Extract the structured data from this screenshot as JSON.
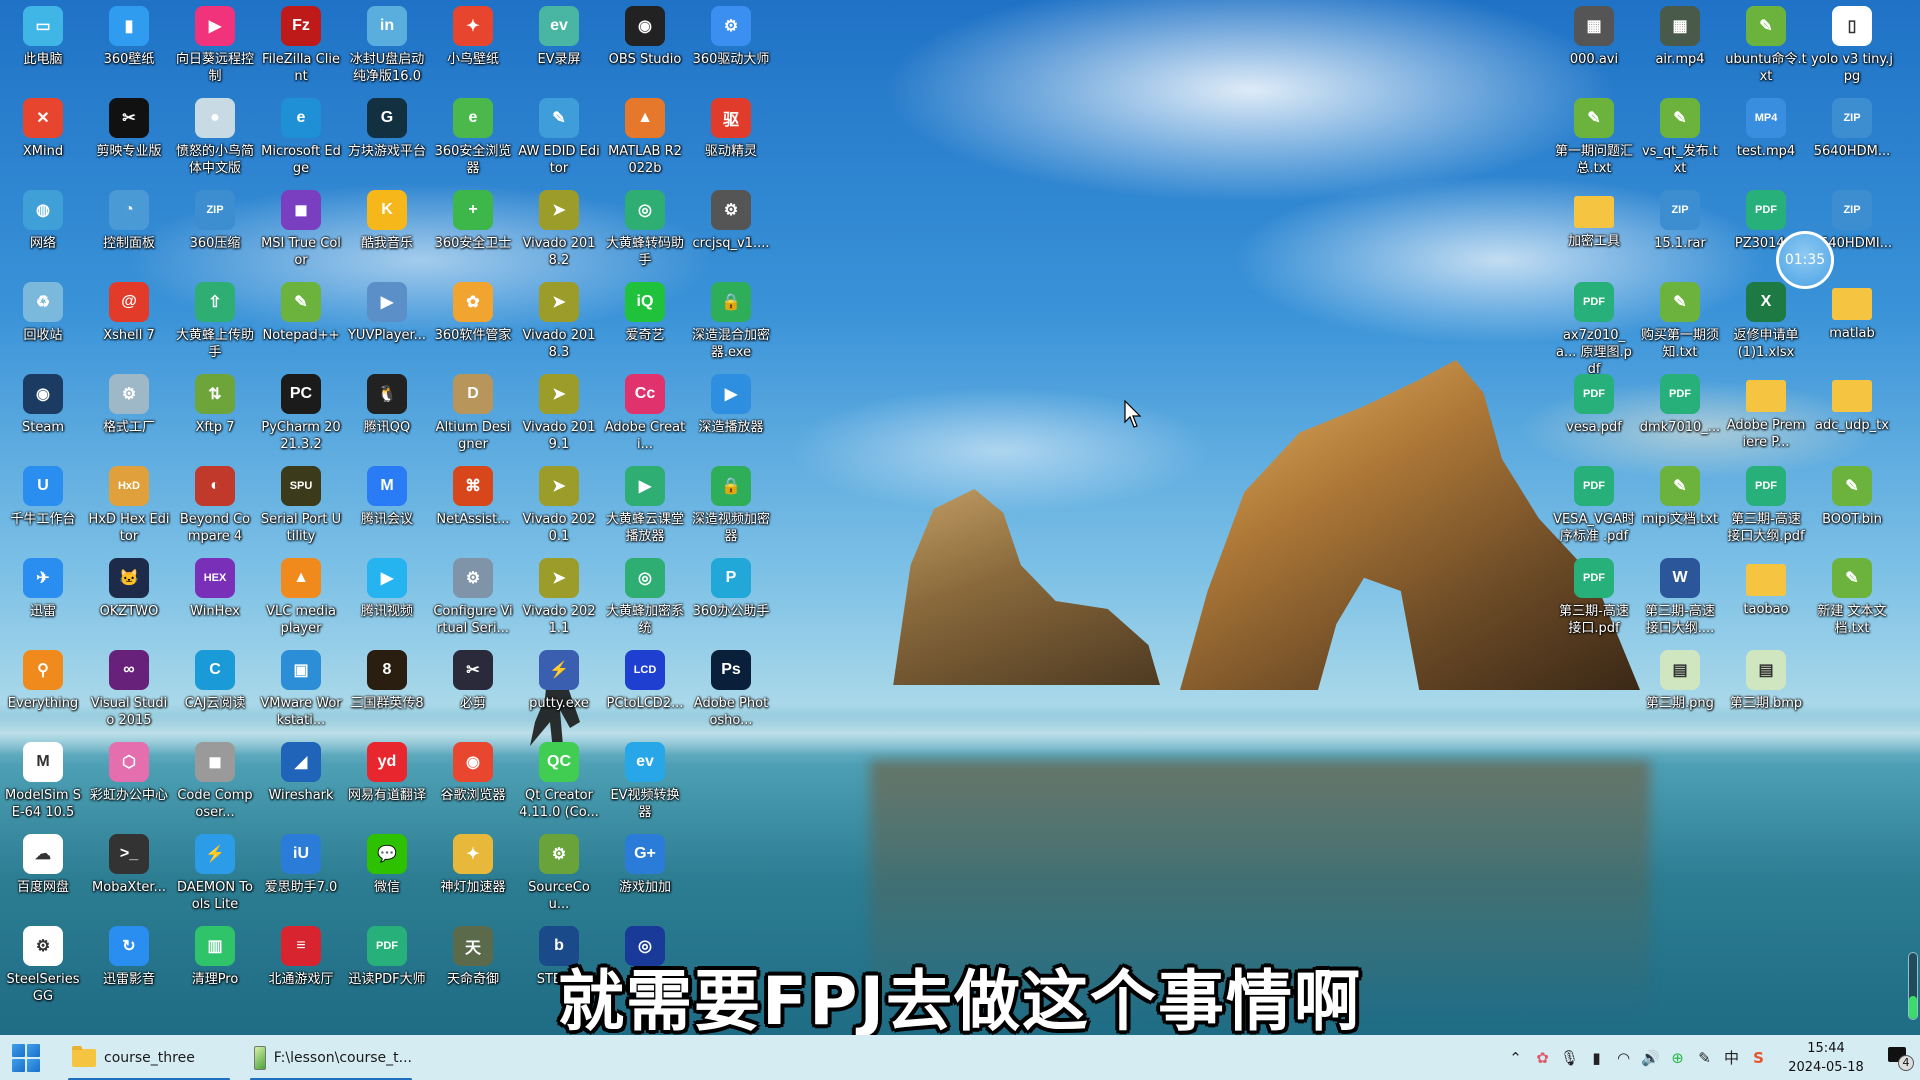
{
  "desktop": {
    "left_icons": [
      {
        "label": "此电脑",
        "icon": "this-pc-icon",
        "color": "#3fb6e6",
        "glyph": "▭"
      },
      {
        "label": "360壁纸",
        "icon": "360-wallpaper-icon",
        "color": "#2f9cf0",
        "glyph": "▮"
      },
      {
        "label": "向日葵远程控制",
        "icon": "sunlogin-icon",
        "color": "#f0337a",
        "glyph": "▶"
      },
      {
        "label": "FileZilla Client",
        "icon": "filezilla-icon",
        "color": "#bf1a1a",
        "glyph": "Fz"
      },
      {
        "label": "冰封U盘启动纯净版16.0",
        "icon": "usb-boot-icon",
        "color": "#5aaede",
        "glyph": "in"
      },
      {
        "label": "小鸟壁纸",
        "icon": "bird-wallpaper-icon",
        "color": "#e8452f",
        "glyph": "✦"
      },
      {
        "label": "EV录屏",
        "icon": "ev-recorder-icon",
        "color": "#49b6a4",
        "glyph": "ev"
      },
      {
        "label": "OBS Studio",
        "icon": "obs-icon",
        "color": "#222222",
        "glyph": "◉"
      },
      {
        "label": "360驱动大师",
        "icon": "360-driver-icon",
        "color": "#3a8ff0",
        "glyph": "⚙"
      },
      {
        "label": "XMind",
        "icon": "xmind-icon",
        "color": "#e8452f",
        "glyph": "✕"
      },
      {
        "label": "剪映专业版",
        "icon": "capcut-icon",
        "color": "#111111",
        "glyph": "✂"
      },
      {
        "label": "愤怒的小鸟简体中文版",
        "icon": "angry-birds-icon",
        "color": "#c8dbe4",
        "glyph": "●"
      },
      {
        "label": "Microsoft Edge",
        "icon": "edge-icon",
        "color": "#1f8fd6",
        "glyph": "e"
      },
      {
        "label": "方块游戏平台",
        "icon": "block-games-icon",
        "color": "#12303f",
        "glyph": "G"
      },
      {
        "label": "360安全浏览器",
        "icon": "360-browser-icon",
        "color": "#4cb84c",
        "glyph": "e"
      },
      {
        "label": "AW EDID Editor",
        "icon": "edid-editor-icon",
        "color": "#3f9ed9",
        "glyph": "✎"
      },
      {
        "label": "MATLAB R2022b",
        "icon": "matlab-icon",
        "color": "#e5782a",
        "glyph": "▲"
      },
      {
        "label": "驱动精灵",
        "icon": "driver-genius-icon",
        "color": "#e13b2c",
        "glyph": "驱"
      },
      {
        "label": "网络",
        "icon": "network-icon",
        "color": "#3fa0d8",
        "glyph": "◍"
      },
      {
        "label": "控制面板",
        "icon": "control-panel-icon",
        "color": "#4a9ad6",
        "glyph": "◔"
      },
      {
        "label": "360压缩",
        "icon": "360-zip-icon",
        "color": "#3c8ed0",
        "glyph": "ZIP"
      },
      {
        "label": "MSI True Color",
        "icon": "msi-truecolor-icon",
        "color": "#7a3fc0",
        "glyph": "◼"
      },
      {
        "label": "酷我音乐",
        "icon": "kuwo-music-icon",
        "color": "#f6b71a",
        "glyph": "K"
      },
      {
        "label": "360安全卫士",
        "icon": "360-security-icon",
        "color": "#3db74a",
        "glyph": "+"
      },
      {
        "label": "Vivado 2018.2",
        "icon": "vivado-icon",
        "color": "#9c9c2a",
        "glyph": "➤"
      },
      {
        "label": "大黄蜂转码助手",
        "icon": "transcode-helper-icon",
        "color": "#2fae74",
        "glyph": "◎"
      },
      {
        "label": "crcjsq_v1....",
        "icon": "crc-calc-icon",
        "color": "#555555",
        "glyph": "⚙"
      },
      {
        "label": "回收站",
        "icon": "recycle-bin-icon",
        "color": "#7ab8dc",
        "glyph": "♻"
      },
      {
        "label": "Xshell 7",
        "icon": "xshell-icon",
        "color": "#e23b2a",
        "glyph": "@"
      },
      {
        "label": "大黄蜂上传助手",
        "icon": "upload-helper-icon",
        "color": "#2fae74",
        "glyph": "⇧"
      },
      {
        "label": "Notepad++",
        "icon": "notepadpp-icon",
        "color": "#6cb33e",
        "glyph": "✎"
      },
      {
        "label": "YUVPlayer...",
        "icon": "yuvplayer-icon",
        "color": "#5b8fc7",
        "glyph": "▶"
      },
      {
        "label": "360软件管家",
        "icon": "360-software-icon",
        "color": "#f1a530",
        "glyph": "✿"
      },
      {
        "label": "Vivado 2018.3",
        "icon": "vivado-icon",
        "color": "#9c9c2a",
        "glyph": "➤"
      },
      {
        "label": "爱奇艺",
        "icon": "iqiyi-icon",
        "color": "#1fc23a",
        "glyph": "iQ"
      },
      {
        "label": "深造混合加密器.exe",
        "icon": "mixed-encryptor-icon",
        "color": "#2fae5a",
        "glyph": "🔒"
      },
      {
        "label": "Steam",
        "icon": "steam-icon",
        "color": "#1b3b63",
        "glyph": "◉"
      },
      {
        "label": "格式工厂",
        "icon": "format-factory-icon",
        "color": "#9fb8c8",
        "glyph": "⚙"
      },
      {
        "label": "Xftp 7",
        "icon": "xftp-icon",
        "color": "#6ea53a",
        "glyph": "⇅"
      },
      {
        "label": "PyCharm 2021.3.2",
        "icon": "pycharm-icon",
        "color": "#1b1b1b",
        "glyph": "PC"
      },
      {
        "label": "腾讯QQ",
        "icon": "qq-icon",
        "color": "#222222",
        "glyph": "🐧"
      },
      {
        "label": "Altium Designer",
        "icon": "altium-icon",
        "color": "#b8955a",
        "glyph": "D"
      },
      {
        "label": "Vivado 2019.1",
        "icon": "vivado-icon",
        "color": "#9c9c2a",
        "glyph": "➤"
      },
      {
        "label": "Adobe Creati...",
        "icon": "adobe-cc-icon",
        "color": "#e0336d",
        "glyph": "Cc"
      },
      {
        "label": "深造播放器",
        "icon": "shenzao-player-icon",
        "color": "#2e8fe0",
        "glyph": "▶"
      },
      {
        "label": "千牛工作台",
        "icon": "qianniu-icon",
        "color": "#2a8ef0",
        "glyph": "U"
      },
      {
        "label": "HxD Hex Editor",
        "icon": "hxd-icon",
        "color": "#e0a13c",
        "glyph": "HxD"
      },
      {
        "label": "Beyond Compare 4",
        "icon": "beyond-compare-icon",
        "color": "#c0392b",
        "glyph": "◐"
      },
      {
        "label": "Serial Port Utility",
        "icon": "serial-port-icon",
        "color": "#3b3a1a",
        "glyph": "SPU"
      },
      {
        "label": "腾讯会议",
        "icon": "tencent-meeting-icon",
        "color": "#2a7cf6",
        "glyph": "M"
      },
      {
        "label": "NetAssist...",
        "icon": "netassist-icon",
        "color": "#d8471c",
        "glyph": "⌘"
      },
      {
        "label": "Vivado 2020.1",
        "icon": "vivado-icon",
        "color": "#9c9c2a",
        "glyph": "➤"
      },
      {
        "label": "大黄蜂云课堂播放器",
        "icon": "cloud-class-player-icon",
        "color": "#2fae74",
        "glyph": "▶"
      },
      {
        "label": "深造视频加密器",
        "icon": "video-encryptor-icon",
        "color": "#2fae5a",
        "glyph": "🔒"
      },
      {
        "label": "迅雷",
        "icon": "xunlei-icon",
        "color": "#2a8ef0",
        "glyph": "✈"
      },
      {
        "label": "OKZTWO",
        "icon": "okztwo-icon",
        "color": "#1e2a4a",
        "glyph": "🐱"
      },
      {
        "label": "WinHex",
        "icon": "winhex-icon",
        "color": "#7a2fb8",
        "glyph": "HEX"
      },
      {
        "label": "VLC media player",
        "icon": "vlc-icon",
        "color": "#f08a1c",
        "glyph": "▲"
      },
      {
        "label": "腾讯视频",
        "icon": "tencent-video-icon",
        "color": "#25b4f0",
        "glyph": "▶"
      },
      {
        "label": "Configure Virtual Seri...",
        "icon": "virtual-serial-icon",
        "color": "#7f94a8",
        "glyph": "⚙"
      },
      {
        "label": "Vivado 2021.1",
        "icon": "vivado-icon",
        "color": "#9c9c2a",
        "glyph": "➤"
      },
      {
        "label": "大黄蜂加密系统",
        "icon": "encryption-system-icon",
        "color": "#2fae74",
        "glyph": "◎"
      },
      {
        "label": "360办公助手",
        "icon": "360-office-icon",
        "color": "#22a8d8",
        "glyph": "P"
      },
      {
        "label": "Everything",
        "icon": "everything-icon",
        "color": "#f08a1c",
        "glyph": "⚲"
      },
      {
        "label": "Visual Studio 2015",
        "icon": "visual-studio-icon",
        "color": "#68217a",
        "glyph": "∞"
      },
      {
        "label": "CAJ云阅读",
        "icon": "caj-reader-icon",
        "color": "#1a9ad6",
        "glyph": "C"
      },
      {
        "label": "VMware Workstati...",
        "icon": "vmware-icon",
        "color": "#2c8ed6",
        "glyph": "▣"
      },
      {
        "label": "三国群英传8",
        "icon": "sanguo-icon",
        "color": "#2a1e10",
        "glyph": "8"
      },
      {
        "label": "必剪",
        "icon": "bijian-icon",
        "color": "#2a2a3a",
        "glyph": "✂"
      },
      {
        "label": "putty.exe",
        "icon": "putty-icon",
        "color": "#3a5fb0",
        "glyph": "⚡"
      },
      {
        "label": "PCtoLCD2...",
        "icon": "pctolcd-icon",
        "color": "#1f3fd0",
        "glyph": "LCD"
      },
      {
        "label": "Adobe Photosho...",
        "icon": "photoshop-icon",
        "color": "#0a1f3a",
        "glyph": "Ps"
      },
      {
        "label": "ModelSim SE-64 10.5",
        "icon": "modelsim-icon",
        "color": "#ffffff",
        "glyph": "M"
      },
      {
        "label": "彩虹办公中心",
        "icon": "rainbow-office-icon",
        "color": "#e56fae",
        "glyph": "⬡"
      },
      {
        "label": "Code Composer...",
        "icon": "code-composer-icon",
        "color": "#9a9a9a",
        "glyph": "◼"
      },
      {
        "label": "Wireshark",
        "icon": "wireshark-icon",
        "color": "#1f64b8",
        "glyph": "◢"
      },
      {
        "label": "网易有道翻译",
        "icon": "youdao-icon",
        "color": "#e8262e",
        "glyph": "yd"
      },
      {
        "label": "谷歌浏览器",
        "icon": "chrome-icon",
        "color": "#e8462f",
        "glyph": "◉"
      },
      {
        "label": "Qt Creator 4.11.0 (Co...",
        "icon": "qt-creator-icon",
        "color": "#41cd52",
        "glyph": "QC"
      },
      {
        "label": "EV视频转换器",
        "icon": "ev-converter-icon",
        "color": "#27a6e8",
        "glyph": "ev"
      },
      null,
      {
        "label": "百度网盘",
        "icon": "baidu-netdisk-icon",
        "color": "#ffffff",
        "glyph": "☁"
      },
      {
        "label": "MobaXter...",
        "icon": "mobaxterm-icon",
        "color": "#333333",
        "glyph": ">_"
      },
      {
        "label": "DAEMON Tools Lite",
        "icon": "daemon-tools-icon",
        "color": "#2c9be8",
        "glyph": "⚡"
      },
      {
        "label": "爱思助手7.0",
        "icon": "i4-helper-icon",
        "color": "#2a7cd8",
        "glyph": "iU"
      },
      {
        "label": "微信",
        "icon": "wechat-icon",
        "color": "#2dc100",
        "glyph": "💬"
      },
      {
        "label": "神灯加速器",
        "icon": "shendeng-accelerator-icon",
        "color": "#e8b83a",
        "glyph": "✦"
      },
      {
        "label": "SourceCou...",
        "icon": "sourcecounter-icon",
        "color": "#6aa33a",
        "glyph": "⚙"
      },
      {
        "label": "游戏加加",
        "icon": "game-plus-icon",
        "color": "#2a7cd8",
        "glyph": "G+"
      },
      null,
      {
        "label": "SteelSeries GG",
        "icon": "steelseries-icon",
        "color": "#ffffff",
        "glyph": "⚙"
      },
      {
        "label": "迅雷影音",
        "icon": "xunlei-player-icon",
        "color": "#2a8ef0",
        "glyph": "↻"
      },
      {
        "label": "清理Pro",
        "icon": "cleaner-pro-icon",
        "color": "#2fc36a",
        "glyph": "▥"
      },
      {
        "label": "北通游戏厅",
        "icon": "betop-games-icon",
        "color": "#d8242e",
        "glyph": "≡"
      },
      {
        "label": "迅读PDF大师",
        "icon": "xundu-pdf-icon",
        "color": "#27b07a",
        "glyph": "PDF"
      },
      {
        "label": "天命奇御",
        "icon": "tianming-icon",
        "color": "#5a6a4a",
        "glyph": "天"
      },
      {
        "label": "STEAM",
        "icon": "steam-shortcut-icon",
        "color": "#1a4a8a",
        "glyph": "b"
      },
      {
        "label": "",
        "icon": "monitor-app-icon",
        "color": "#1a3a9a",
        "glyph": "◎"
      },
      null
    ],
    "right_icons": [
      {
        "label": "000.avi",
        "icon": "video-file-icon",
        "color": "#555555",
        "glyph": "▦"
      },
      {
        "label": "air.mp4",
        "icon": "video-file-icon",
        "color": "#4a5a4a",
        "glyph": "▦"
      },
      {
        "label": "ubuntu命令.txt",
        "icon": "notepadpp-file-icon",
        "color": "#6cb33e",
        "glyph": "✎"
      },
      {
        "label": "yolo v3 tiny.jpg",
        "icon": "image-file-icon",
        "color": "#ffffff",
        "glyph": "▯"
      },
      {
        "label": "第一期问题汇总.txt",
        "icon": "notepadpp-file-icon",
        "color": "#6cb33e",
        "glyph": "✎"
      },
      {
        "label": "vs_qt_发布.txt",
        "icon": "notepadpp-file-icon",
        "color": "#6cb33e",
        "glyph": "✎"
      },
      {
        "label": "test.mp4",
        "icon": "mp4-file-icon",
        "color": "#3a8ee0",
        "glyph": "MP4"
      },
      {
        "label": "5640HDM...",
        "icon": "zip-file-icon",
        "color": "#3c8ed0",
        "glyph": "ZIP"
      },
      {
        "label": "加密工具",
        "icon": "folder-icon",
        "color": "#f5c542",
        "glyph": ""
      },
      {
        "label": "15.1.rar",
        "icon": "zip-file-icon",
        "color": "#3c8ed0",
        "glyph": "ZIP"
      },
      {
        "label": "PZ3014...",
        "icon": "pdf-file-icon",
        "color": "#27b07a",
        "glyph": "PDF"
      },
      {
        "label": "5640HDMI...",
        "icon": "zip-file-icon",
        "color": "#3c8ed0",
        "glyph": "ZIP"
      },
      {
        "label": "ax7z010_a... 原理图.pdf",
        "icon": "pdf-file-icon",
        "color": "#27b07a",
        "glyph": "PDF"
      },
      {
        "label": "购买第一期须知.txt",
        "icon": "notepadpp-file-icon",
        "color": "#6cb33e",
        "glyph": "✎"
      },
      {
        "label": "返修申请单(1)1.xlsx",
        "icon": "excel-file-icon",
        "color": "#1d7a43",
        "glyph": "X"
      },
      {
        "label": "matlab",
        "icon": "folder-icon",
        "color": "#f5c542",
        "glyph": ""
      },
      {
        "label": "vesa.pdf",
        "icon": "pdf-file-icon",
        "color": "#27b07a",
        "glyph": "PDF"
      },
      {
        "label": "dmk7010_...",
        "icon": "pdf-file-icon",
        "color": "#27b07a",
        "glyph": "PDF"
      },
      {
        "label": "Adobe Premiere P...",
        "icon": "folder-icon",
        "color": "#f5c542",
        "glyph": ""
      },
      {
        "label": "adc_udp_tx",
        "icon": "folder-icon",
        "color": "#f5c542",
        "glyph": ""
      },
      {
        "label": "VESA_VGA时序标准 .pdf",
        "icon": "pdf-file-icon",
        "color": "#27b07a",
        "glyph": "PDF"
      },
      {
        "label": "mipi文档.txt",
        "icon": "notepadpp-file-icon",
        "color": "#6cb33e",
        "glyph": "✎"
      },
      {
        "label": "第三期-高速接口大纲.pdf",
        "icon": "pdf-file-icon",
        "color": "#27b07a",
        "glyph": "PDF"
      },
      {
        "label": "BOOT.bin",
        "icon": "notepadpp-file-icon",
        "color": "#6cb33e",
        "glyph": "✎"
      },
      {
        "label": "第三期-高速接口.pdf",
        "icon": "pdf-file-icon",
        "color": "#27b07a",
        "glyph": "PDF"
      },
      {
        "label": "第三期-高速接口大纲....",
        "icon": "word-file-icon",
        "color": "#2b579a",
        "glyph": "W"
      },
      {
        "label": "taobao",
        "icon": "folder-icon",
        "color": "#f5c542",
        "glyph": ""
      },
      {
        "label": "新建 文本文档.txt",
        "icon": "notepadpp-file-icon",
        "color": "#6cb33e",
        "glyph": "✎"
      },
      null,
      {
        "label": "第三期.png",
        "icon": "image-file-icon",
        "color": "#cfe6c0",
        "glyph": "▤"
      },
      {
        "label": "第三期.bmp",
        "icon": "image-file-icon",
        "color": "#cfe6c0",
        "glyph": "▤"
      },
      null
    ]
  },
  "overlay": {
    "subtitle": "就需要FPJ去做这个事情啊",
    "recording_timer": "01:35",
    "level_meter_fraction": 0.35
  },
  "taskbar": {
    "items": [
      {
        "label": "course_three",
        "icon": "folder-icon"
      },
      {
        "label": "F:\\lesson\\course_t...",
        "icon": "notepadpp-icon"
      }
    ],
    "tray": {
      "icons": [
        "chevron-up-icon",
        "pinwheel-icon",
        "microphone-icon",
        "battery-icon",
        "wifi-icon",
        "volume-icon",
        "360-security-tray-icon",
        "pen-icon",
        "ime-icon",
        "sogou-icon"
      ],
      "ime_label": "中",
      "time": "15:44",
      "date": "2024-05-18",
      "notification_count": "4"
    }
  }
}
